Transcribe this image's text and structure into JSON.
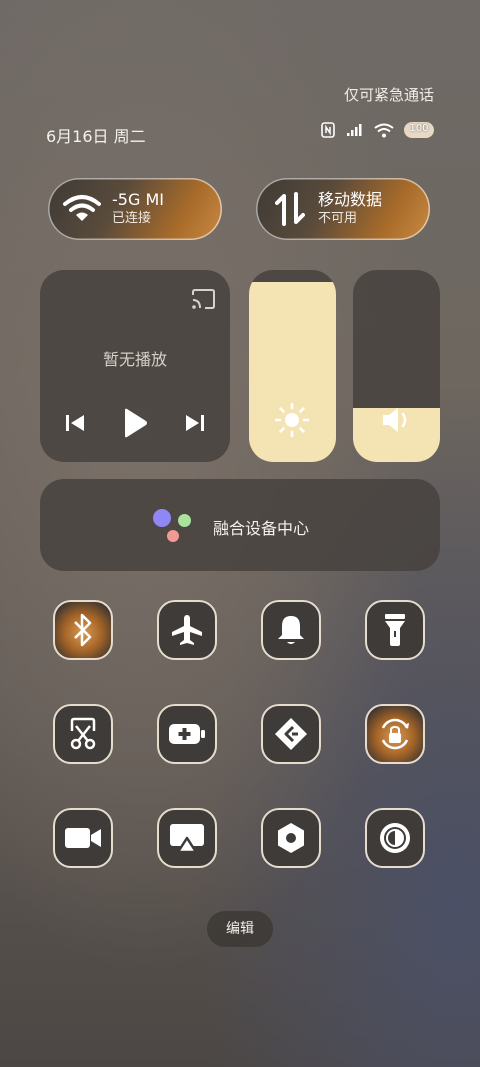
{
  "status": {
    "top_text": "仅可紧急通话",
    "date": "6月16日 周二",
    "battery": "100"
  },
  "wifi_tile": {
    "name": "-5G  MI",
    "status": "已连接",
    "icon": "wifi-icon"
  },
  "data_tile": {
    "name": "移动数据",
    "status": "不可用",
    "icon": "mobile-data-icon"
  },
  "media": {
    "title": "暂无播放"
  },
  "brightness": {
    "level": 0.94
  },
  "volume": {
    "level": 0.28
  },
  "fusion": {
    "label": "融合设备中心"
  },
  "toggles": [
    {
      "name": "bluetooth",
      "icon": "bluetooth-icon",
      "active": true
    },
    {
      "name": "airplane-mode",
      "icon": "airplane-icon",
      "active": false
    },
    {
      "name": "sound",
      "icon": "bell-icon",
      "active": false
    },
    {
      "name": "flashlight",
      "icon": "flashlight-icon",
      "active": false
    },
    {
      "name": "screenshot",
      "icon": "scissors-icon",
      "active": false
    },
    {
      "name": "battery-saver",
      "icon": "battery-plus-icon",
      "active": false
    },
    {
      "name": "nfc-share",
      "icon": "share-icon",
      "active": false
    },
    {
      "name": "rotation-lock",
      "icon": "rotation-lock-icon",
      "active": true
    },
    {
      "name": "screen-record",
      "icon": "video-camera-icon",
      "active": false
    },
    {
      "name": "cast-screen",
      "icon": "cast-icon",
      "active": false
    },
    {
      "name": "settings",
      "icon": "hexagon-settings-icon",
      "active": false
    },
    {
      "name": "dark-mode",
      "icon": "contrast-icon",
      "active": false
    }
  ],
  "edit_label": "编辑"
}
